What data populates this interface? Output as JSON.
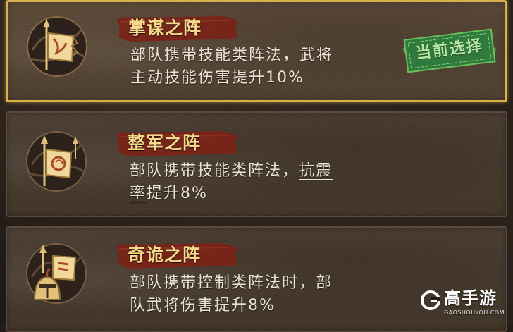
{
  "formations": [
    {
      "title": "掌谋之阵",
      "desc_line1": "部队携带技能类阵法，武将",
      "desc_line2": "主动技能伤害提升10%",
      "emblem_icon": "banner-spear-icon",
      "selected": true
    },
    {
      "title": "整军之阵",
      "desc_line1_a": "部队携带技能类阵法，",
      "desc_keyword": "抗震率",
      "desc_keyword_part1": "抗震",
      "desc_keyword_part2": "率",
      "desc_line2_b": "提升8%",
      "emblem_icon": "banner-spear-icon",
      "selected": false
    },
    {
      "title": "奇诡之阵",
      "desc_line1": "部队携带控制类阵法时，部",
      "desc_line2": "队武将伤害提升8%",
      "emblem_icon": "helmet-banner-icon",
      "selected": false
    }
  ],
  "selected_badge": {
    "label": "当前选择"
  },
  "watermark": {
    "name": "高手游",
    "domain": "GAOSHOUYOU.COM",
    "icon": "g-logo-icon"
  },
  "colors": {
    "selected_border": "#d7b24a",
    "title_gold": "#f4d98a",
    "banner_red": "#7a2418",
    "badge_green": "#2f7a3c"
  }
}
